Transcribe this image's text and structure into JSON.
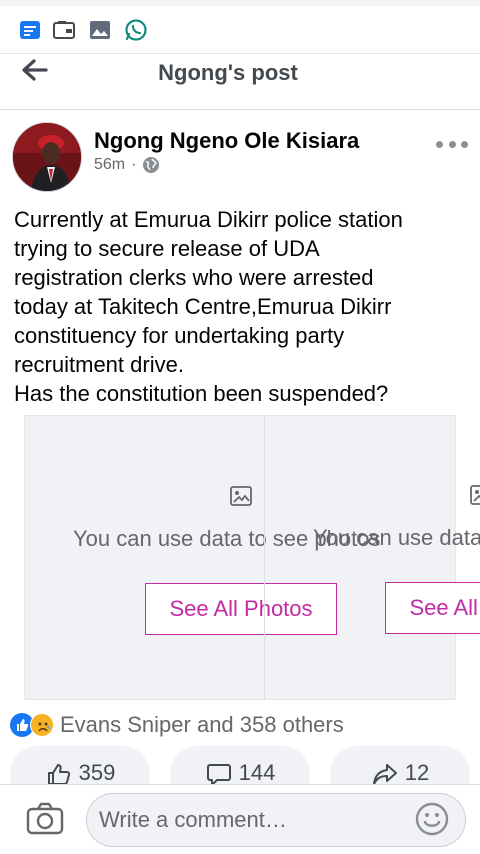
{
  "status_bar": {
    "icons": [
      "message-icon",
      "wallet-icon",
      "gallery-icon",
      "whatsapp-icon"
    ]
  },
  "app_bar": {
    "title": "Ngong's post",
    "back_icon": "back-arrow-icon"
  },
  "post": {
    "author": "Ngong Ngeno Ole Kisiara",
    "time": "56m",
    "separator": "·",
    "audience_icon": "globe-icon",
    "more_icon": "more-dots-icon",
    "text_lines": [
      "Currently at Emurua Dikirr police station",
      "trying to secure release of UDA",
      "registration clerks who were arrested",
      "today at Takitech Centre,Emurua Dikirr",
      "constituency for undertaking party",
      "recruitment drive.",
      "Has the constitution been suspended?"
    ]
  },
  "photos": {
    "notice": "You can use data to see photos",
    "notice_2": "You can use data to see photos",
    "see_all": "See All Photos",
    "see_all_2": "See All Photos"
  },
  "reactions": {
    "icons": [
      "like-icon",
      "care-icon"
    ],
    "label": "Evans Sniper and 358 others"
  },
  "actions": {
    "likes": "359",
    "comments": "144",
    "shares": "12"
  },
  "composer": {
    "placeholder": "Write a comment…"
  },
  "colors": {
    "accent": "#c32aa3",
    "like_blue": "#1877f2",
    "text_secondary": "#65676b",
    "whatsapp": "#25d366"
  }
}
